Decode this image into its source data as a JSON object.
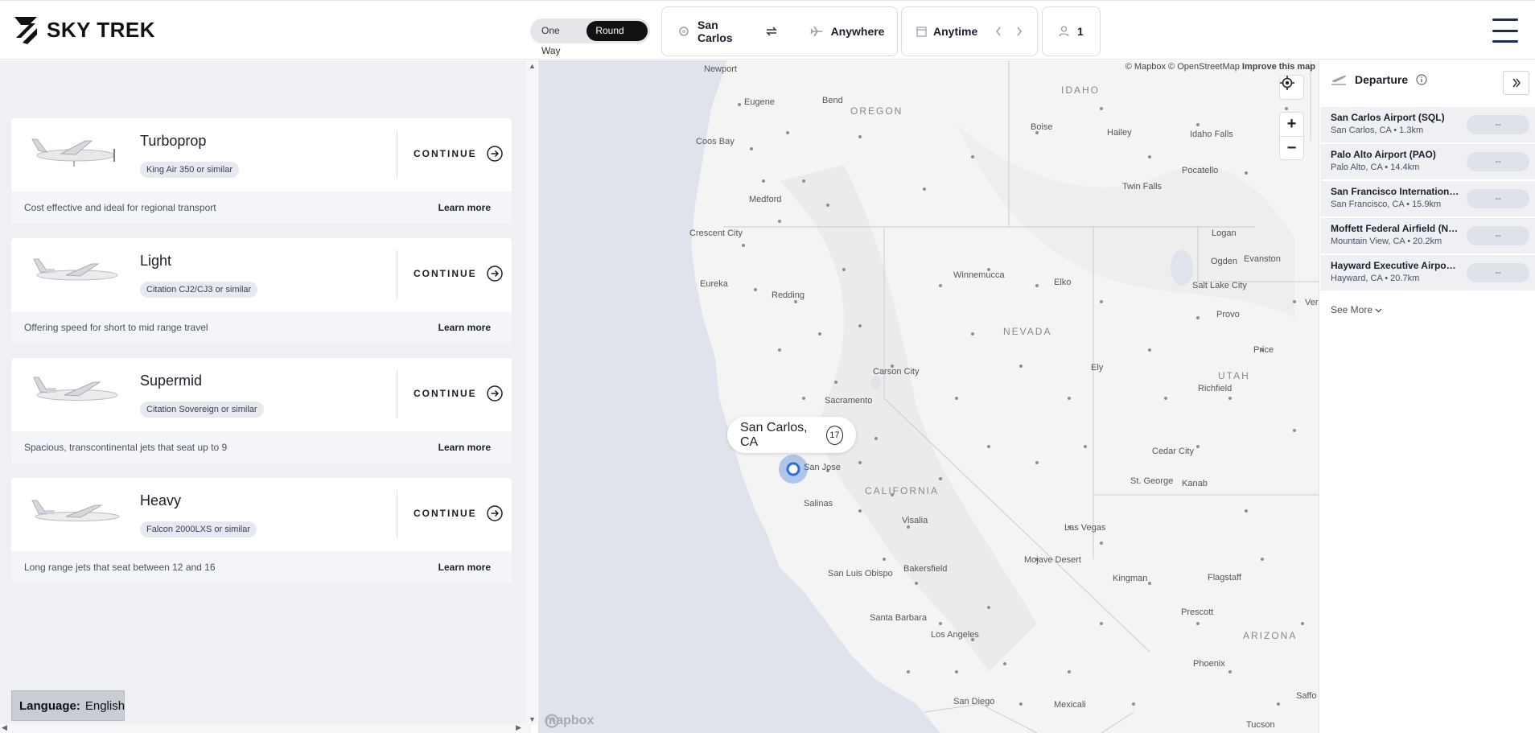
{
  "brand": {
    "name": "SKY TREK"
  },
  "trip_type": {
    "options": [
      "One Way",
      "Round Trip"
    ],
    "selected": "Round Trip"
  },
  "search": {
    "from": "San Carlos",
    "to": "Anywhere",
    "date": "Anytime",
    "passengers": "1"
  },
  "aircraft": [
    {
      "title": "Turboprop",
      "badge": "King Air 350 or similar",
      "continue": "CONTINUE",
      "description": "Cost effective and ideal for regional transport",
      "learn_more": "Learn more"
    },
    {
      "title": "Light",
      "badge": "Citation CJ2/CJ3 or similar",
      "continue": "CONTINUE",
      "description": "Offering speed for short to mid range travel",
      "learn_more": "Learn more"
    },
    {
      "title": "Supermid",
      "badge": "Citation Sovereign or similar",
      "continue": "CONTINUE",
      "description": "Spacious, transcontinental jets that seat up to 9",
      "learn_more": "Learn more"
    },
    {
      "title": "Heavy",
      "badge": "Falcon 2000LXS or similar",
      "continue": "CONTINUE",
      "description": "Long range jets that seat between 12 and 16",
      "learn_more": "Learn more"
    }
  ],
  "language": {
    "label": "Language:",
    "value": "English"
  },
  "map": {
    "attribution": [
      "© Mapbox",
      "© OpenStreetMap",
      "Improve this map"
    ],
    "bubble_label": "San Carlos, CA",
    "bubble_count": "17",
    "logo": "mapbox",
    "states": [
      "OREGON",
      "IDAHO",
      "NEVADA",
      "UTAH",
      "CALIFORNIA",
      "ARIZONA"
    ],
    "cities": [
      "Newport",
      "Eugene",
      "Bend",
      "Coos Bay",
      "Medford",
      "Crescent City",
      "Eureka",
      "Redding",
      "Boise",
      "Hailey",
      "Idaho Falls",
      "Pocatello",
      "Twin Falls",
      "Logan",
      "Ogden",
      "Evanston",
      "Winnemucca",
      "Elko",
      "Salt Lake City",
      "Provo",
      "Carson City",
      "Sacramento",
      "San Jose",
      "Salinas",
      "Ely",
      "Price",
      "Richfield",
      "Cedar City",
      "St. George",
      "Kanab",
      "Visalia",
      "Bakersfield",
      "San Luis Obispo",
      "Santa Barbara",
      "Los Angeles",
      "Las Vegas",
      "Mojave Desert",
      "Kingman",
      "Flagstaff",
      "Prescott",
      "Phoenix",
      "San Diego",
      "Mexicali",
      "Tucson",
      "Ver",
      "Saffo"
    ]
  },
  "departure": {
    "title": "Departure",
    "airports": [
      {
        "name": "San Carlos Airport (SQL)",
        "location": "San Carlos, CA",
        "distance": "1.3km",
        "price": "--"
      },
      {
        "name": "Palo Alto Airport (PAO)",
        "location": "Palo Alto, CA",
        "distance": "14.4km",
        "price": "--"
      },
      {
        "name": "San Francisco International ...",
        "location": "San Francisco, CA",
        "distance": "15.9km",
        "price": "--"
      },
      {
        "name": "Moffett Federal Airfield (NU...",
        "location": "Mountain View, CA",
        "distance": "20.2km",
        "price": "--"
      },
      {
        "name": "Hayward Executive Airport (...",
        "location": "Hayward, CA",
        "distance": "20.7km",
        "price": "--"
      }
    ],
    "see_more": "See More"
  },
  "colors": {
    "accent": "#1b1f2b",
    "map_water": "#dfe3ec",
    "map_land": "#f4f4f4",
    "marker": "#2f6fd0"
  }
}
